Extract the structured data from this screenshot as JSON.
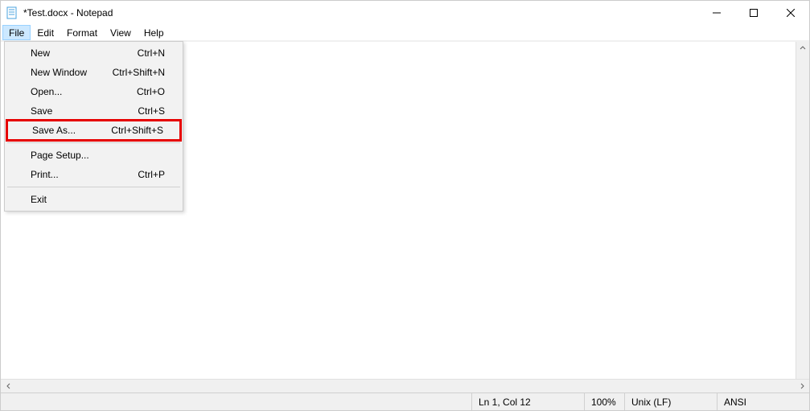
{
  "titlebar": {
    "title": "*Test.docx - Notepad"
  },
  "menubar": {
    "items": [
      "File",
      "Edit",
      "Format",
      "View",
      "Help"
    ],
    "active_index": 0
  },
  "file_menu": {
    "new": {
      "label": "New",
      "shortcut": "Ctrl+N"
    },
    "new_window": {
      "label": "New Window",
      "shortcut": "Ctrl+Shift+N"
    },
    "open": {
      "label": "Open...",
      "shortcut": "Ctrl+O"
    },
    "save": {
      "label": "Save",
      "shortcut": "Ctrl+S"
    },
    "save_as": {
      "label": "Save As...",
      "shortcut": "Ctrl+Shift+S"
    },
    "page_setup": {
      "label": "Page Setup...",
      "shortcut": ""
    },
    "print": {
      "label": "Print...",
      "shortcut": "Ctrl+P"
    },
    "exit": {
      "label": "Exit",
      "shortcut": ""
    }
  },
  "statusbar": {
    "position": "Ln 1, Col 12",
    "zoom": "100%",
    "line_ending": "Unix (LF)",
    "encoding": "ANSI"
  }
}
